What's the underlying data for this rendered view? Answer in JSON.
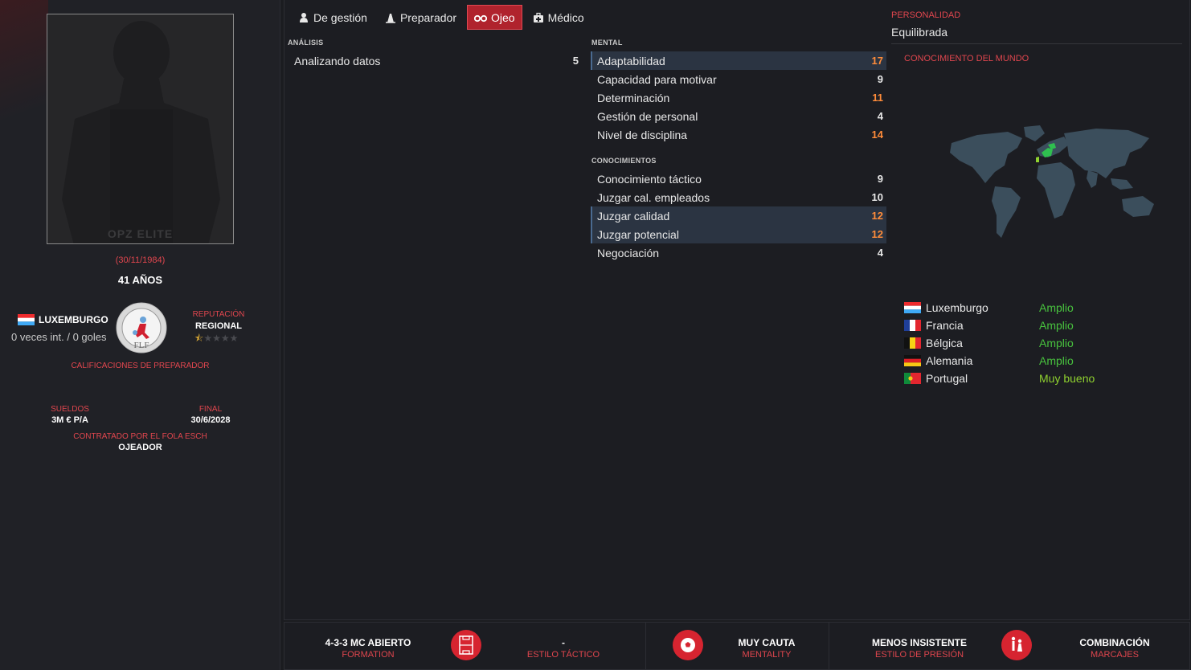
{
  "profile": {
    "photo_watermark": "OPZ ELITE",
    "dob": "(30/11/1984)",
    "age": "41 AÑOS",
    "nation": "LUXEMBURGO",
    "caps": "0 veces int. / 0 goles",
    "crest_text": "FLF",
    "reputation_label": "REPUTACIÓN",
    "reputation_value": "REGIONAL",
    "reputation_stars": 0.5,
    "coach_ratings_link": "CALIFICACIONES DE PREPARADOR",
    "wage_label": "SUELDOS",
    "wage_value": "3M € P/A",
    "end_label": "FINAL",
    "end_value": "30/6/2028",
    "hired_label": "CONTRATADO POR EL FOLA ESCH",
    "role_value": "OJEADOR"
  },
  "tabs": [
    {
      "label": "De gestión",
      "icon": "manager-icon",
      "active": false
    },
    {
      "label": "Preparador",
      "icon": "coach-icon",
      "active": false
    },
    {
      "label": "Ojeo",
      "icon": "binoculars-icon",
      "active": true
    },
    {
      "label": "Médico",
      "icon": "medical-kit-icon",
      "active": false
    }
  ],
  "analysis": {
    "heading": "ANÁLISIS",
    "rows": [
      {
        "label": "Analizando datos",
        "value": "5",
        "highlight": false,
        "orange": false
      }
    ]
  },
  "mental": {
    "heading": "MENTAL",
    "rows": [
      {
        "label": "Adaptabilidad",
        "value": "17",
        "highlight": true,
        "orange": true
      },
      {
        "label": "Capacidad para motivar",
        "value": "9",
        "highlight": false,
        "orange": false
      },
      {
        "label": "Determinación",
        "value": "11",
        "highlight": false,
        "orange": true
      },
      {
        "label": "Gestión de personal",
        "value": "4",
        "highlight": false,
        "orange": false
      },
      {
        "label": "Nivel de disciplina",
        "value": "14",
        "highlight": false,
        "orange": true
      }
    ]
  },
  "knowledge": {
    "heading": "CONOCIMIENTOS",
    "rows": [
      {
        "label": "Conocimiento táctico",
        "value": "9",
        "highlight": false,
        "orange": false
      },
      {
        "label": "Juzgar cal. empleados",
        "value": "10",
        "highlight": false,
        "orange": false
      },
      {
        "label": "Juzgar calidad",
        "value": "12",
        "highlight": true,
        "orange": true
      },
      {
        "label": "Juzgar potencial",
        "value": "12",
        "highlight": true,
        "orange": true
      },
      {
        "label": "Negociación",
        "value": "4",
        "highlight": false,
        "orange": false
      }
    ]
  },
  "personality": {
    "label": "PERSONALIDAD",
    "value": "Equilibrada"
  },
  "world_knowledge": {
    "label": "CONOCIMIENTO DEL MUNDO",
    "countries": [
      {
        "name": "Luxemburgo",
        "level": "Amplio",
        "flag": "lu"
      },
      {
        "name": "Francia",
        "level": "Amplio",
        "flag": "fr"
      },
      {
        "name": "Bélgica",
        "level": "Amplio",
        "flag": "be"
      },
      {
        "name": "Alemania",
        "level": "Amplio",
        "flag": "de"
      },
      {
        "name": "Portugal",
        "level": "Muy bueno",
        "flag": "pt"
      }
    ]
  },
  "bottom_bar": {
    "formation_value": "4-3-3 MC ABIERTO",
    "formation_label": "FORMATION",
    "style_value": "-",
    "style_label": "ESTILO TÁCTICO",
    "mentality_value": "MUY CAUTA",
    "mentality_label": "MENTALITY",
    "pressing_value": "MENOS INSISTENTE",
    "pressing_label": "ESTILO DE PRESIÓN",
    "marking_value": "COMBINACIÓN",
    "marking_label": "MARCAJES"
  },
  "colors": {
    "accent_red": "#e0464e",
    "tab_active": "#b0232d",
    "attribute_high": "#ff8c3a",
    "knowledge_green": "#48c23e"
  }
}
